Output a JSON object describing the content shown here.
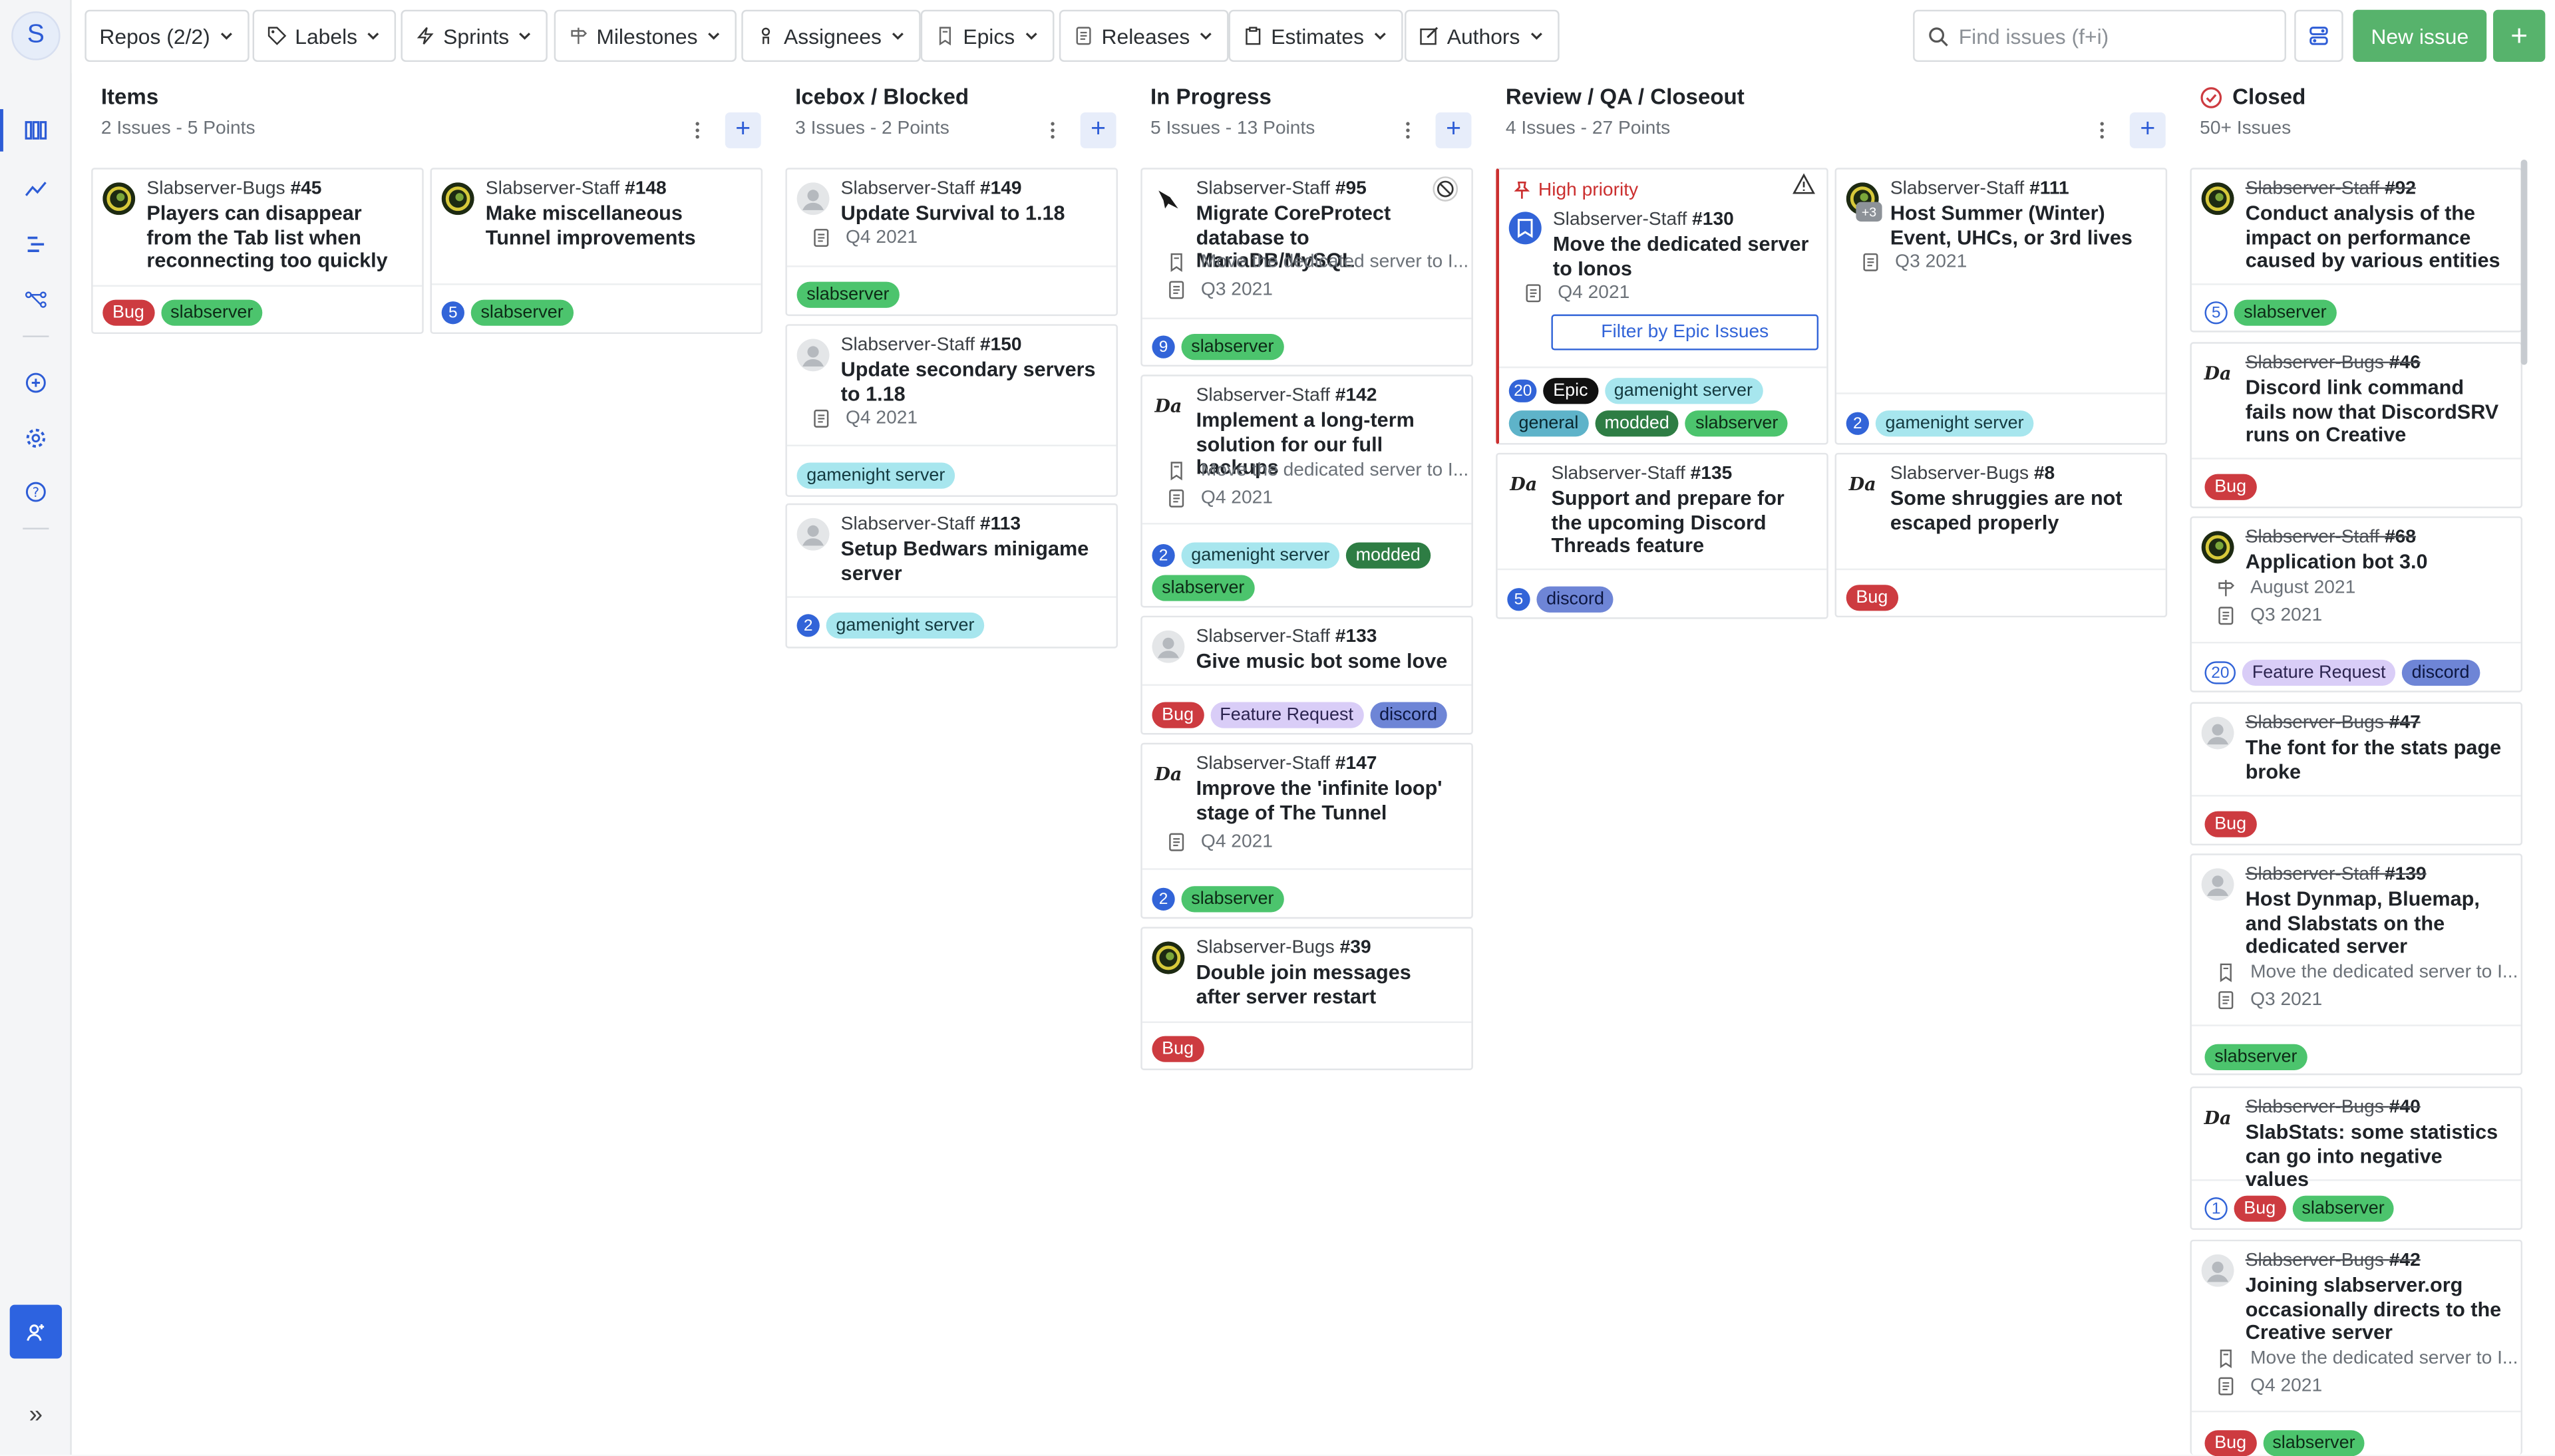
{
  "sidebar": {
    "logo": "S"
  },
  "toolbar": {
    "filters": [
      {
        "label": "Repos (2/2)",
        "icon": "none"
      },
      {
        "label": "Labels",
        "icon": "tag"
      },
      {
        "label": "Sprints",
        "icon": "bolt"
      },
      {
        "label": "Milestones",
        "icon": "signpost"
      },
      {
        "label": "Assignees",
        "icon": "person"
      },
      {
        "label": "Epics",
        "icon": "book"
      },
      {
        "label": "Releases",
        "icon": "doc"
      },
      {
        "label": "Estimates",
        "icon": "clipboard"
      },
      {
        "label": "Authors",
        "icon": "edit"
      }
    ],
    "search_placeholder": "Find issues (f+i)",
    "new_issue": "New issue",
    "plus": "+"
  },
  "columns": [
    {
      "title": "Items",
      "count": "2 Issues",
      "points": "5 Points"
    },
    {
      "title": "Icebox / Blocked",
      "count": "3 Issues",
      "points": "2 Points"
    },
    {
      "title": "In Progress",
      "count": "5 Issues",
      "points": "13 Points"
    },
    {
      "title": "Review / QA / Closeout",
      "count": "4 Issues",
      "points": "27 Points"
    },
    {
      "title": "Closed",
      "count": "50+ Issues"
    }
  ],
  "cards": {
    "c45": {
      "repo": "Slabserver-Bugs ",
      "num": "#45",
      "title": "Players can disappear from the Tab list when reconnecting too quickly",
      "labels": [
        "Bug",
        "slabserver"
      ]
    },
    "c148": {
      "repo": "Slabserver-Staff ",
      "num": "#148",
      "title": "Make miscellaneous Tunnel improvements",
      "est": "5",
      "labels": [
        "slabserver"
      ]
    },
    "c149": {
      "repo": "Slabserver-Staff ",
      "num": "#149",
      "title": "Update Survival to 1.18",
      "release": "Q4 2021",
      "labels": [
        "slabserver"
      ]
    },
    "c150": {
      "repo": "Slabserver-Staff ",
      "num": "#150",
      "title": "Update secondary servers to 1.18",
      "release": "Q4 2021",
      "labels": [
        "gamenight server"
      ]
    },
    "c113": {
      "repo": "Slabserver-Staff ",
      "num": "#113",
      "title": "Setup Bedwars minigame server",
      "est": "2",
      "labels": [
        "gamenight server"
      ]
    },
    "c95": {
      "repo": "Slabserver-Staff ",
      "num": "#95",
      "title": "Migrate CoreProtect database to MariaDB/MySQL",
      "epic": "Move the dedicated server to I...",
      "release": "Q3 2021",
      "est": "9",
      "labels": [
        "slabserver"
      ]
    },
    "c142": {
      "repo": "Slabserver-Staff ",
      "num": "#142",
      "title": "Implement a long-term solution for our full backups",
      "epic": "Move the dedicated server to I...",
      "release": "Q4 2021",
      "est": "2",
      "labels": [
        "gamenight server",
        "modded",
        "slabserver"
      ]
    },
    "c133": {
      "repo": "Slabserver-Staff ",
      "num": "#133",
      "title": "Give music bot some love",
      "labels": [
        "Bug",
        "Feature Request",
        "discord"
      ]
    },
    "c147": {
      "repo": "Slabserver-Staff ",
      "num": "#147",
      "title": "Improve the 'infinite loop' stage of The Tunnel",
      "release": "Q4 2021",
      "est": "2",
      "labels": [
        "slabserver"
      ]
    },
    "c39": {
      "repo": "Slabserver-Bugs ",
      "num": "#39",
      "title": "Double join messages after server restart",
      "labels": [
        "Bug"
      ]
    },
    "c130": {
      "priority": "High priority",
      "repo": "Slabserver-Staff ",
      "num": "#130",
      "title": "Move the dedicated server to Ionos",
      "release": "Q4 2021",
      "filter": "Filter by Epic Issues",
      "est": "20",
      "labels": [
        "Epic",
        "gamenight server",
        "general",
        "modded",
        "slabserver"
      ]
    },
    "c111": {
      "repo": "Slabserver-Staff ",
      "num": "#111",
      "title": "Host Summer (Winter) Event, UHCs, or 3rd lives",
      "release": "Q3 2021",
      "badge": "+3",
      "est": "2",
      "labels": [
        "gamenight server"
      ]
    },
    "c135": {
      "repo": "Slabserver-Staff ",
      "num": "#135",
      "title": "Support and prepare for the upcoming Discord Threads feature",
      "est": "5",
      "labels": [
        "discord"
      ]
    },
    "c8": {
      "repo": "Slabserver-Bugs ",
      "num": "#8",
      "title": "Some shruggies are not escaped properly",
      "labels": [
        "Bug"
      ]
    },
    "c92": {
      "repo": "Slabserver-Staff ",
      "num": "#92",
      "title": "Conduct analysis of the impact on performance caused by various entities",
      "est": "5",
      "labels": [
        "slabserver"
      ]
    },
    "c46": {
      "repo": "Slabserver-Bugs ",
      "num": "#46",
      "title": "Discord link command fails now that DiscordSRV runs on Creative",
      "labels": [
        "Bug"
      ]
    },
    "c68": {
      "repo": "Slabserver-Staff ",
      "num": "#68",
      "title": "Application bot 3.0",
      "milestone": "August 2021",
      "release": "Q3 2021",
      "est": "20",
      "labels": [
        "Feature Request",
        "discord"
      ]
    },
    "c47": {
      "repo": "Slabserver-Bugs ",
      "num": "#47",
      "title": "The font for the stats page broke",
      "labels": [
        "Bug"
      ]
    },
    "c139": {
      "repo": "Slabserver-Staff ",
      "num": "#139",
      "title": "Host Dynmap, Bluemap, and Slabstats on the dedicated server",
      "epic": "Move the dedicated server to I...",
      "release": "Q3 2021",
      "labels": [
        "slabserver"
      ]
    },
    "c40": {
      "repo": "Slabserver-Bugs ",
      "num": "#40",
      "title": "SlabStats: some statistics can go into negative values",
      "est": "1",
      "labels": [
        "Bug",
        "slabserver"
      ]
    },
    "c42": {
      "repo": "Slabserver-Bugs ",
      "num": "#42",
      "title": "Joining slabserver.org occasionally directs to the Creative server",
      "epic": "Move the dedicated server to I...",
      "release": "Q4 2021",
      "labels": [
        "Bug",
        "slabserver"
      ]
    }
  },
  "colors": {
    "accent": "#2d5cd6",
    "green": "#57b36c",
    "bug": "#cd3b40",
    "priority": "#cb2f2f"
  }
}
